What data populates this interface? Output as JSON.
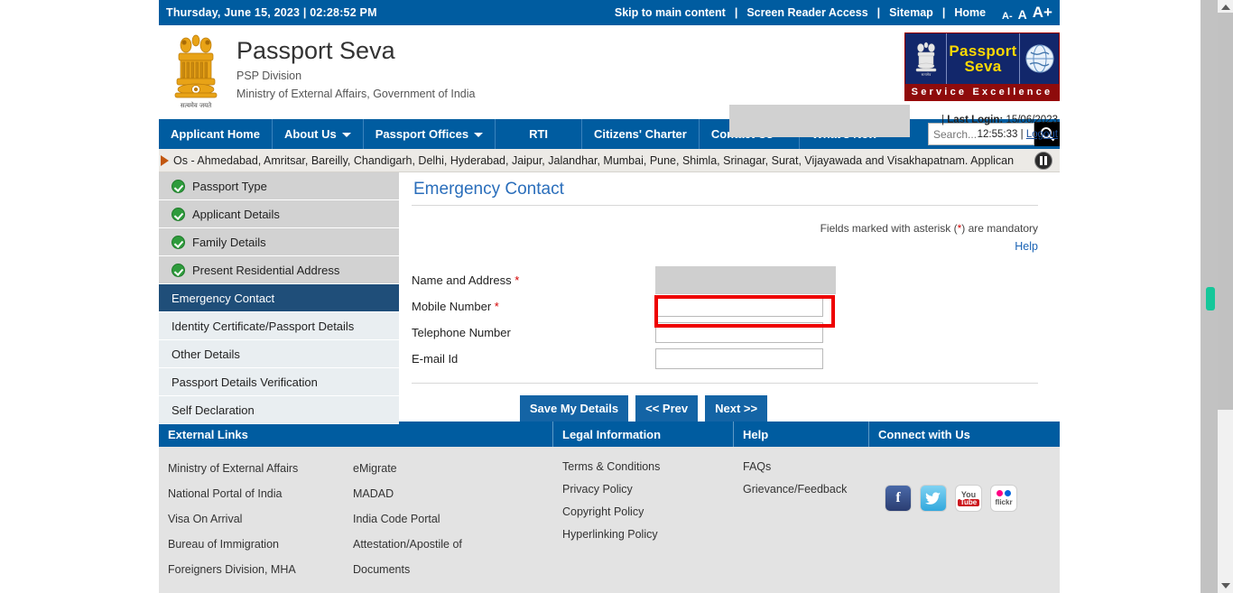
{
  "topbar": {
    "datetime": "Thursday,  June  15, 2023 | 02:28:52 PM",
    "links": [
      {
        "label": "Skip to main content",
        "name": "skip-to-main-content-link"
      },
      {
        "label": "Screen Reader Access",
        "name": "screen-reader-access-link"
      },
      {
        "label": "Sitemap",
        "name": "sitemap-link"
      },
      {
        "label": "Home",
        "name": "home-link"
      }
    ],
    "separator": "|",
    "font_small": "A-",
    "font_medium": "A",
    "font_large": "A+"
  },
  "masthead": {
    "title": "Passport Seva",
    "subtitle1": "PSP Division",
    "subtitle2": "Ministry of External Affairs, Government of India",
    "emblem_motto": "सत्यमेव जयते",
    "logo": {
      "word1": "Passport",
      "word2": "Seva",
      "band": "Service Excellence"
    },
    "last_login_label": "Last Login:",
    "last_login_date": "15/06/2023",
    "last_login_time": "12:55:33",
    "pipe": "|",
    "logout_label": "Logout"
  },
  "mainnav": {
    "items": [
      {
        "label": "Applicant Home",
        "caret": false,
        "name": "nav-applicant-home"
      },
      {
        "label": "About Us",
        "caret": true,
        "name": "nav-about-us"
      },
      {
        "label": "Passport Offices",
        "caret": true,
        "name": "nav-passport-offices"
      },
      {
        "label": "RTI",
        "caret": false,
        "name": "nav-rti"
      },
      {
        "label": "Citizens' Charter",
        "caret": false,
        "name": "nav-citizens-charter"
      },
      {
        "label": "Contact Us",
        "caret": true,
        "name": "nav-contact-us"
      },
      {
        "label": "What's New",
        "caret": false,
        "name": "nav-whats-new"
      }
    ],
    "search_placeholder": "Search...",
    "search_value": ""
  },
  "ticker": {
    "text": "Os - Ahmedabad, Amritsar, Bareilly, Chandigarh, Delhi, Hyderabad, Jaipur, Jalandhar, Mumbai, Pune, Shimla, Srinagar, Surat, Vijayawada and Visakhapatnam. Applican"
  },
  "sidebar": {
    "steps": [
      {
        "label": "Passport Type",
        "state": "done"
      },
      {
        "label": "Applicant Details",
        "state": "done"
      },
      {
        "label": "Family Details",
        "state": "done"
      },
      {
        "label": "Present Residential Address",
        "state": "done"
      },
      {
        "label": "Emergency Contact",
        "state": "active"
      },
      {
        "label": "Identity Certificate/Passport Details",
        "state": "todo"
      },
      {
        "label": "Other Details",
        "state": "todo"
      },
      {
        "label": "Passport Details Verification",
        "state": "todo"
      },
      {
        "label": "Self Declaration",
        "state": "todo"
      }
    ]
  },
  "panel": {
    "title": "Emergency Contact",
    "mandatory_note_pre": "Fields marked with asterisk (",
    "mandatory_note_ast": "*",
    "mandatory_note_post": ") are mandatory",
    "help_label": "Help",
    "fields": [
      {
        "label": "Name and Address",
        "required": true,
        "value": "",
        "redacted": true,
        "name": "name-and-address-field"
      },
      {
        "label": "Mobile Number",
        "required": true,
        "value": "",
        "redacted": false,
        "name": "mobile-number-field",
        "highlighted": true
      },
      {
        "label": "Telephone Number",
        "required": false,
        "value": "",
        "redacted": false,
        "name": "telephone-number-field"
      },
      {
        "label": "E-mail Id",
        "required": false,
        "value": "",
        "redacted": false,
        "name": "email-id-field"
      }
    ],
    "buttons": [
      {
        "label": "Save My Details",
        "name": "save-my-details-button"
      },
      {
        "label": "<< Prev",
        "name": "prev-button"
      },
      {
        "label": "Next >>",
        "name": "next-button"
      }
    ]
  },
  "footer": {
    "headers": [
      {
        "label": "External Links",
        "name": "footer-header-external-links"
      },
      {
        "label": "Legal Information",
        "name": "footer-header-legal-information"
      },
      {
        "label": "Help",
        "name": "footer-header-help"
      },
      {
        "label": "Connect with Us",
        "name": "footer-header-connect-with-us"
      }
    ],
    "external_links_col1": [
      "Ministry of External Affairs",
      "National Portal of India",
      "Visa On Arrival",
      "Bureau of Immigration",
      "Foreigners Division, MHA"
    ],
    "external_links_col2": [
      "eMigrate",
      "MADAD",
      "India Code Portal",
      "Attestation/Apostile of",
      "Documents"
    ],
    "legal_links": [
      "Terms & Conditions",
      "Privacy Policy",
      "Copyright Policy",
      "Hyperlinking Policy"
    ],
    "help_links": [
      "FAQs",
      "Grievance/Feedback"
    ],
    "social": [
      {
        "name": "facebook-icon",
        "label": "f"
      },
      {
        "name": "twitter-icon",
        "label": "t"
      },
      {
        "name": "youtube-icon",
        "label": "You Tube"
      },
      {
        "name": "flickr-icon",
        "label": "flickr"
      }
    ]
  },
  "colors": {
    "brand_blue": "#005ca0",
    "active_step": "#1f4e79",
    "button_blue": "#1464a5",
    "highlight_red": "#ee0000",
    "link_blue": "#1a63b5",
    "check_green": "#2e9b3c",
    "scroll_marker": "#16c79a"
  }
}
